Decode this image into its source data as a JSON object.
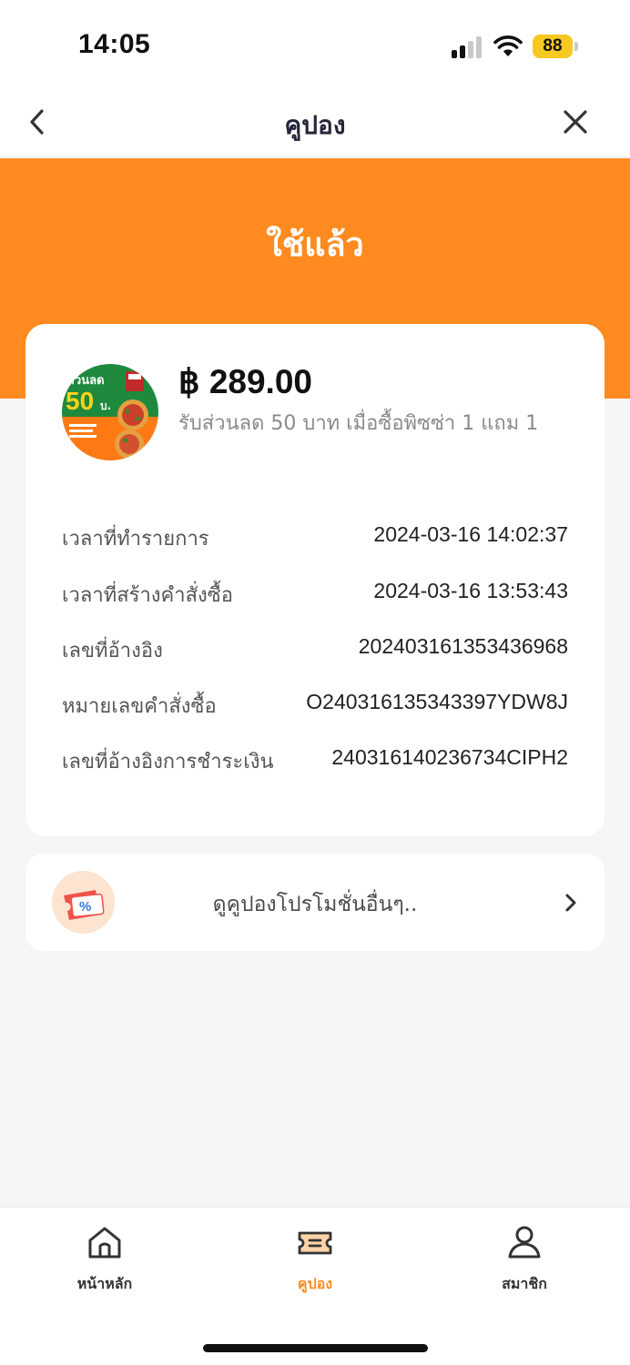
{
  "status_bar": {
    "time": "14:05",
    "battery": "88"
  },
  "nav": {
    "title": "คูปอง"
  },
  "banner": {
    "status_text": "ใช้แล้ว"
  },
  "coupon": {
    "image_text_top": "ส่วนลด",
    "image_text_amount": "50",
    "image_text_unit": "บ.",
    "price": "฿ 289.00",
    "description": "รับส่วนลด 50 บาท เมื่อซื้อพิซซ่า 1 แถม 1"
  },
  "details": [
    {
      "label": "เวลาที่ทำรายการ",
      "value": "2024-03-16 14:02:37"
    },
    {
      "label": "เวลาที่สร้างคำสั่งซื้อ",
      "value": "2024-03-16 13:53:43"
    },
    {
      "label": "เลขที่อ้างอิง",
      "value": "202403161353436968"
    },
    {
      "label": "หมายเลขคำสั่งซื้อ",
      "value": "O240316135343397YDW8J"
    },
    {
      "label": "เลขที่อ้างอิงการชำระเงิน",
      "value": "240316140236734CIPH2"
    }
  ],
  "promo": {
    "label": "ดูคูปองโปรโมชั่นอื่นๆ.."
  },
  "tabs": [
    {
      "label": "หน้าหลัก",
      "icon": "home-icon"
    },
    {
      "label": "คูปอง",
      "icon": "coupon-icon"
    },
    {
      "label": "สมาชิก",
      "icon": "person-icon"
    }
  ],
  "colors": {
    "accent": "#ff8a20",
    "battery": "#f7c820"
  }
}
